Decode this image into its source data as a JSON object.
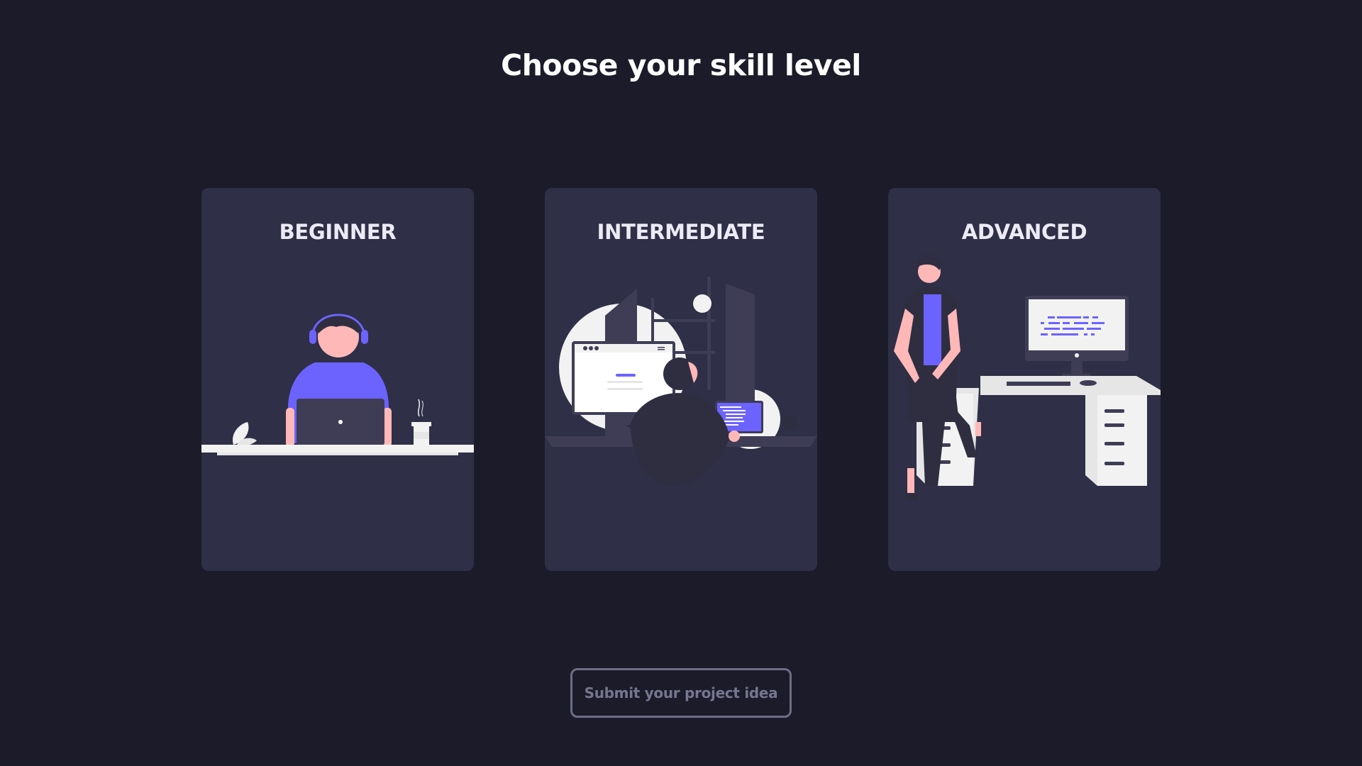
{
  "page": {
    "title": "Choose your skill level"
  },
  "levels": [
    {
      "label": "BEGINNER",
      "illustration": "person-with-headphones-at-laptop"
    },
    {
      "label": "INTERMEDIATE",
      "illustration": "developer-at-computer-desk"
    },
    {
      "label": "ADVANCED",
      "illustration": "person-leaning-by-desk-with-monitor"
    }
  ],
  "submit": {
    "label": "Submit your project idea"
  },
  "colors": {
    "background": "#1b1b2a",
    "card": "#2f2f47",
    "accent": "#6c63ff",
    "skin": "#ffb8b8",
    "desk": "#f2f2f2"
  }
}
